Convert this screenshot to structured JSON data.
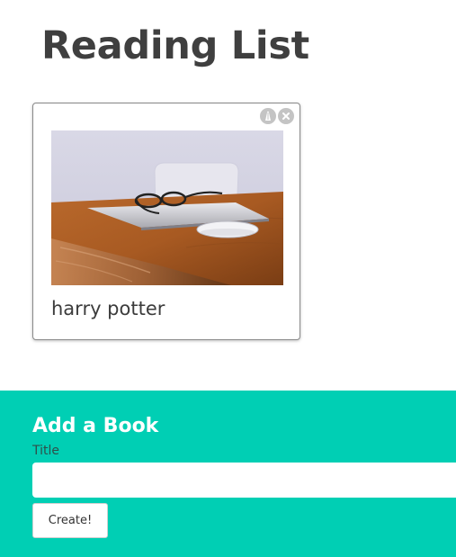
{
  "header": {
    "title": "Reading List"
  },
  "books": [
    {
      "title": "harry potter",
      "image_description": "laptop-with-glasses-and-mouse-on-wooden-desk",
      "actions": [
        {
          "name": "edit-icon"
        },
        {
          "name": "delete-icon"
        }
      ]
    }
  ],
  "add_book": {
    "heading": "Add a Book",
    "title_label": "Title",
    "title_value": "",
    "title_placeholder": "",
    "submit_label": "Create!"
  },
  "colors": {
    "accent": "#00cfb4",
    "title_text": "#3f3f3f",
    "action_icon_bg": "#c4c4c4"
  }
}
